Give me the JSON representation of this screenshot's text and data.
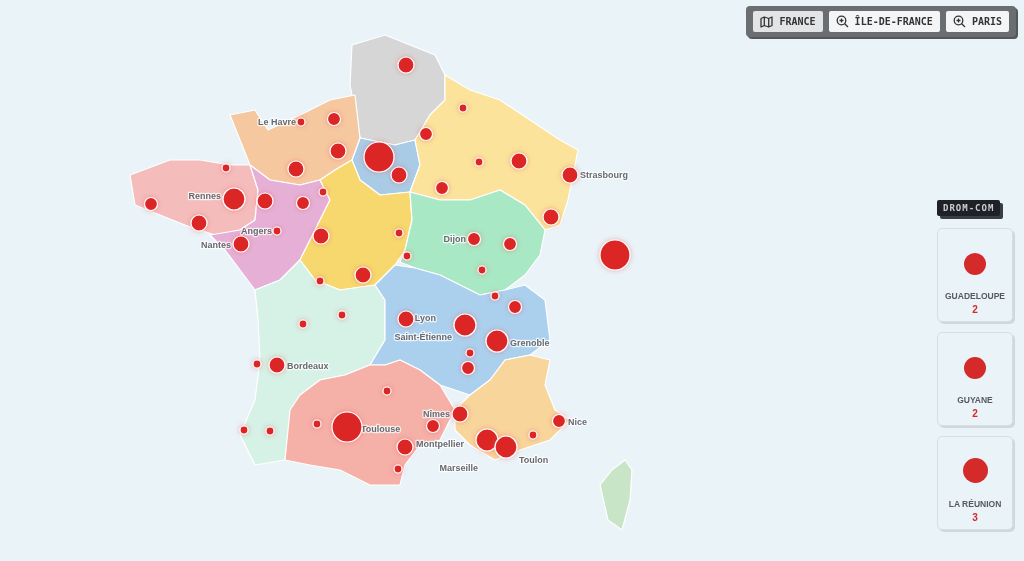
{
  "toolbar": [
    {
      "kind": "map",
      "label": "FRANCE",
      "selected": true
    },
    {
      "kind": "zoom",
      "label": "ÎLE-DE-FRANCE",
      "selected": false
    },
    {
      "kind": "zoom",
      "label": "PARIS",
      "selected": false
    }
  ],
  "map": {
    "regions": [
      {
        "color": "#d6d6d6"
      },
      {
        "color": "#a9cbe6"
      },
      {
        "color": "#fbe39b"
      },
      {
        "color": "#f6c8a0"
      },
      {
        "color": "#f5bcbc"
      },
      {
        "color": "#e6b0d6"
      },
      {
        "color": "#f7d86e"
      },
      {
        "color": "#a9e8c4"
      },
      {
        "color": "#d6f1e6"
      },
      {
        "color": "#abd0ee"
      },
      {
        "color": "#f5b0a8"
      },
      {
        "color": "#f8d59b"
      },
      {
        "color": "#c8e5c8"
      }
    ],
    "markers": [
      {
        "kind": "m"
      },
      {
        "kind": "s"
      },
      {
        "kind": "xs"
      },
      {
        "kind": "s"
      },
      {
        "kind": "xs"
      },
      {
        "kind": "xl"
      },
      {
        "kind": "m"
      },
      {
        "kind": "m"
      },
      {
        "kind": "m"
      },
      {
        "kind": "xs"
      },
      {
        "kind": "xs"
      },
      {
        "kind": "l"
      },
      {
        "kind": "m"
      },
      {
        "kind": "s"
      },
      {
        "kind": "s"
      },
      {
        "kind": "m"
      },
      {
        "kind": "xs"
      },
      {
        "kind": "m"
      },
      {
        "kind": "m"
      },
      {
        "kind": "xs"
      },
      {
        "kind": "xs"
      },
      {
        "kind": "m"
      },
      {
        "kind": "xs"
      },
      {
        "kind": "xs"
      },
      {
        "kind": "m"
      },
      {
        "kind": "s"
      },
      {
        "kind": "m"
      },
      {
        "kind": "m"
      },
      {
        "kind": "s"
      },
      {
        "kind": "s"
      },
      {
        "kind": "xs"
      },
      {
        "kind": "xl"
      },
      {
        "kind": "xs"
      },
      {
        "kind": "s"
      },
      {
        "kind": "m"
      },
      {
        "kind": "l"
      },
      {
        "kind": "l"
      },
      {
        "kind": "xs"
      },
      {
        "kind": "xs"
      },
      {
        "kind": "xs"
      },
      {
        "kind": "s"
      },
      {
        "kind": "m"
      },
      {
        "kind": "xs"
      },
      {
        "kind": "xs"
      },
      {
        "kind": "m"
      },
      {
        "kind": "s"
      },
      {
        "kind": "xl"
      },
      {
        "kind": "xs"
      },
      {
        "kind": "m"
      },
      {
        "kind": "xs"
      },
      {
        "kind": "l"
      },
      {
        "kind": "l"
      },
      {
        "kind": "xs"
      },
      {
        "kind": "s"
      },
      {
        "kind": "xs"
      },
      {
        "kind": "xs"
      }
    ],
    "city_labels": [
      {
        "text": "Le Havre"
      },
      {
        "text": "Strasbourg"
      },
      {
        "text": "Rennes"
      },
      {
        "text": "Angers"
      },
      {
        "text": "Nantes"
      },
      {
        "text": "Dijon"
      },
      {
        "text": "Lyon"
      },
      {
        "text": "Saint-Étienne"
      },
      {
        "text": "Grenoble"
      },
      {
        "text": "Bordeaux"
      },
      {
        "text": "Toulouse"
      },
      {
        "text": "Nîmes"
      },
      {
        "text": "Montpellier"
      },
      {
        "text": "Marseille"
      },
      {
        "text": "Toulon"
      },
      {
        "text": "Nice"
      }
    ]
  },
  "drom_com": {
    "title": "DROM-COM",
    "items": [
      {
        "name": "GUADELOUPE",
        "count": "2",
        "kind": "m"
      },
      {
        "name": "GUYANE",
        "count": "2",
        "kind": "m"
      },
      {
        "name": "LA RÉUNION",
        "count": "3",
        "kind": "l"
      }
    ]
  }
}
